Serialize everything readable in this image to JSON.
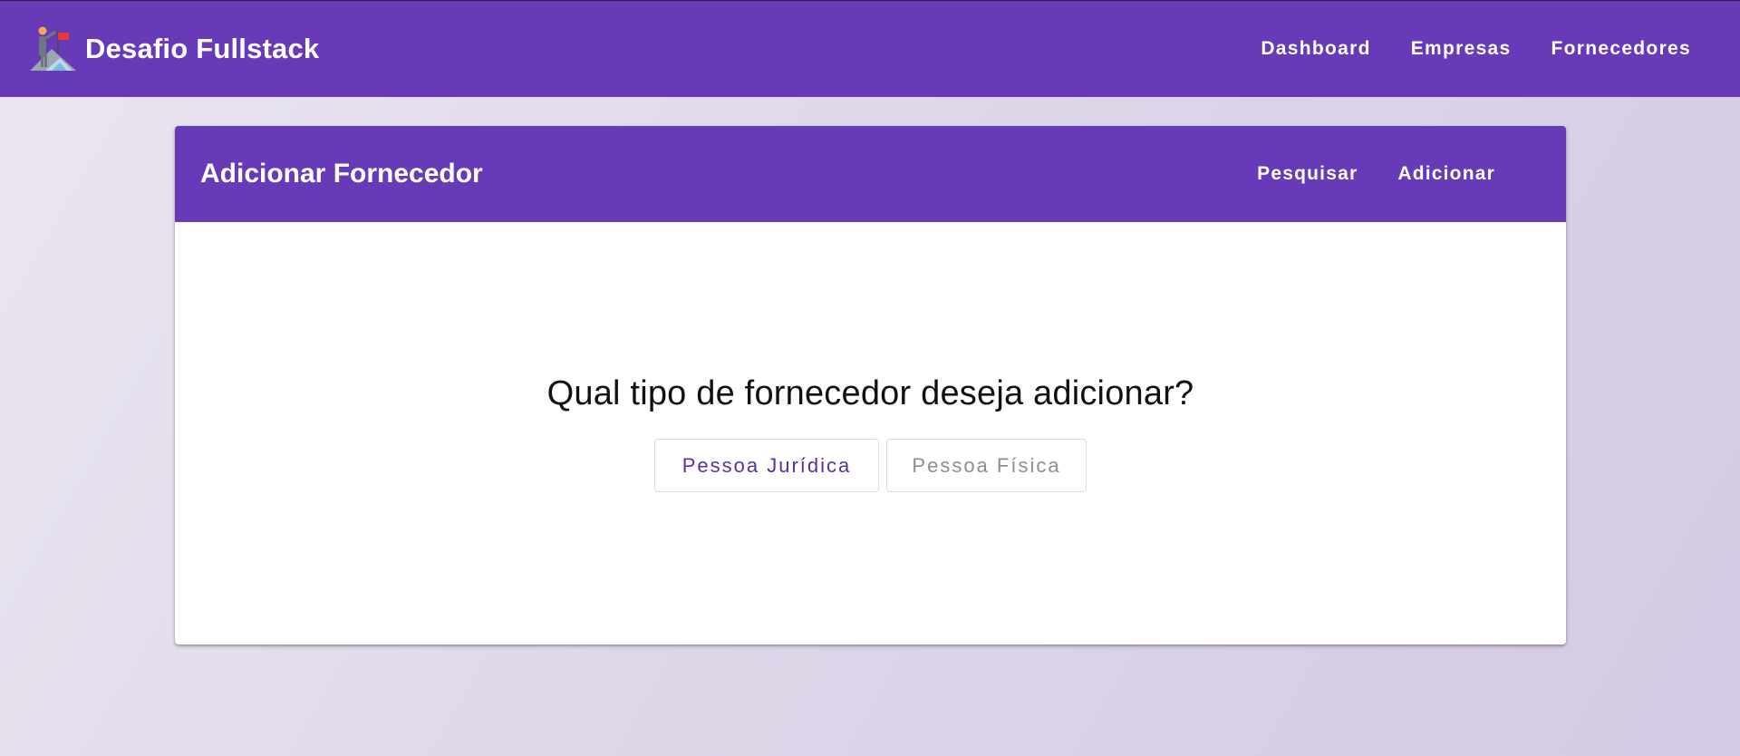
{
  "app": {
    "title": "Desafio Fullstack",
    "logo_icon": "mountain-flag-icon"
  },
  "topnav": {
    "items": [
      {
        "label": "Dashboard"
      },
      {
        "label": "Empresas"
      },
      {
        "label": "Fornecedores"
      }
    ]
  },
  "card": {
    "title": "Adicionar Fornecedor",
    "actions": [
      {
        "label": "Pesquisar"
      },
      {
        "label": "Adicionar"
      }
    ],
    "question": "Qual tipo de fornecedor deseja adicionar?",
    "options": [
      {
        "label": "Pessoa Jurídica",
        "selected": true
      },
      {
        "label": "Pessoa Física",
        "selected": false
      }
    ]
  },
  "colors": {
    "primary": "#673ab7",
    "selected_text": "#5a30a4",
    "unselected_text": "#8e8e8e"
  }
}
